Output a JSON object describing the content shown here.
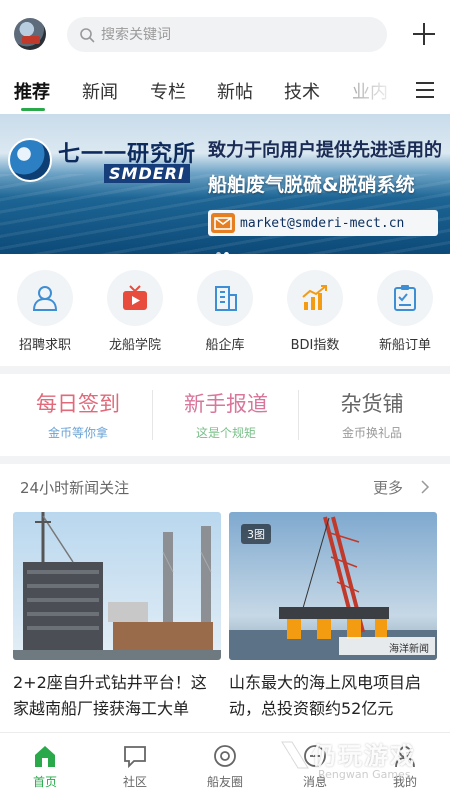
{
  "header": {
    "search_placeholder": "搜索关键词",
    "avatar_icon": "user-avatar",
    "search_icon": "search-icon",
    "add_icon": "plus-icon"
  },
  "tabs": [
    {
      "label": "推荐",
      "active": true
    },
    {
      "label": "新闻"
    },
    {
      "label": "专栏"
    },
    {
      "label": "新帖"
    },
    {
      "label": "技术"
    },
    {
      "label": "业内"
    }
  ],
  "banner": {
    "org_name": "七一一研究所",
    "org_abbr": "SMDERI",
    "slogan": "致力于向用户提供先进适用的",
    "product": "船舶废气脱硫&脱硝系统",
    "email": "market@smderi-mect.cn",
    "slides": 2,
    "active_slide": 2
  },
  "quick_links": [
    {
      "label": "招聘求职",
      "icon": "people-icon"
    },
    {
      "label": "龙船学院",
      "icon": "tv-icon"
    },
    {
      "label": "船企库",
      "icon": "building-icon"
    },
    {
      "label": "BDI指数",
      "icon": "chart-icon"
    },
    {
      "label": "新船订单",
      "icon": "clipboard-icon"
    }
  ],
  "features": [
    {
      "title": "每日签到",
      "subtitle": "金币等你拿"
    },
    {
      "title": "新手报道",
      "subtitle": "这是个规矩"
    },
    {
      "title": "杂货铺",
      "subtitle": "金币换礼品"
    }
  ],
  "news": {
    "section_title": "24小时新闻关注",
    "more_label": "更多",
    "items": [
      {
        "headline": "2+2座自升式钻井平台！这家越南船厂接获海工大单"
      },
      {
        "headline": "山东最大的海上风电项目启动，总投资额约52亿元",
        "badge": "3图",
        "image_tag": "海洋新闻"
      }
    ]
  },
  "bottom_nav": [
    {
      "label": "首页",
      "icon": "home-icon",
      "active": true
    },
    {
      "label": "社区",
      "icon": "chat-icon"
    },
    {
      "label": "船友圈",
      "icon": "compass-icon"
    },
    {
      "label": "消息",
      "icon": "bell-icon"
    },
    {
      "label": "我的",
      "icon": "person-icon"
    }
  ],
  "watermark": {
    "cn": "仍玩游戏",
    "en": "Rengwan Games"
  },
  "colors": {
    "accent": "#2aa94b",
    "sign_in": "#e0697a",
    "new_user": "#d9769c",
    "shop": "#666666"
  }
}
